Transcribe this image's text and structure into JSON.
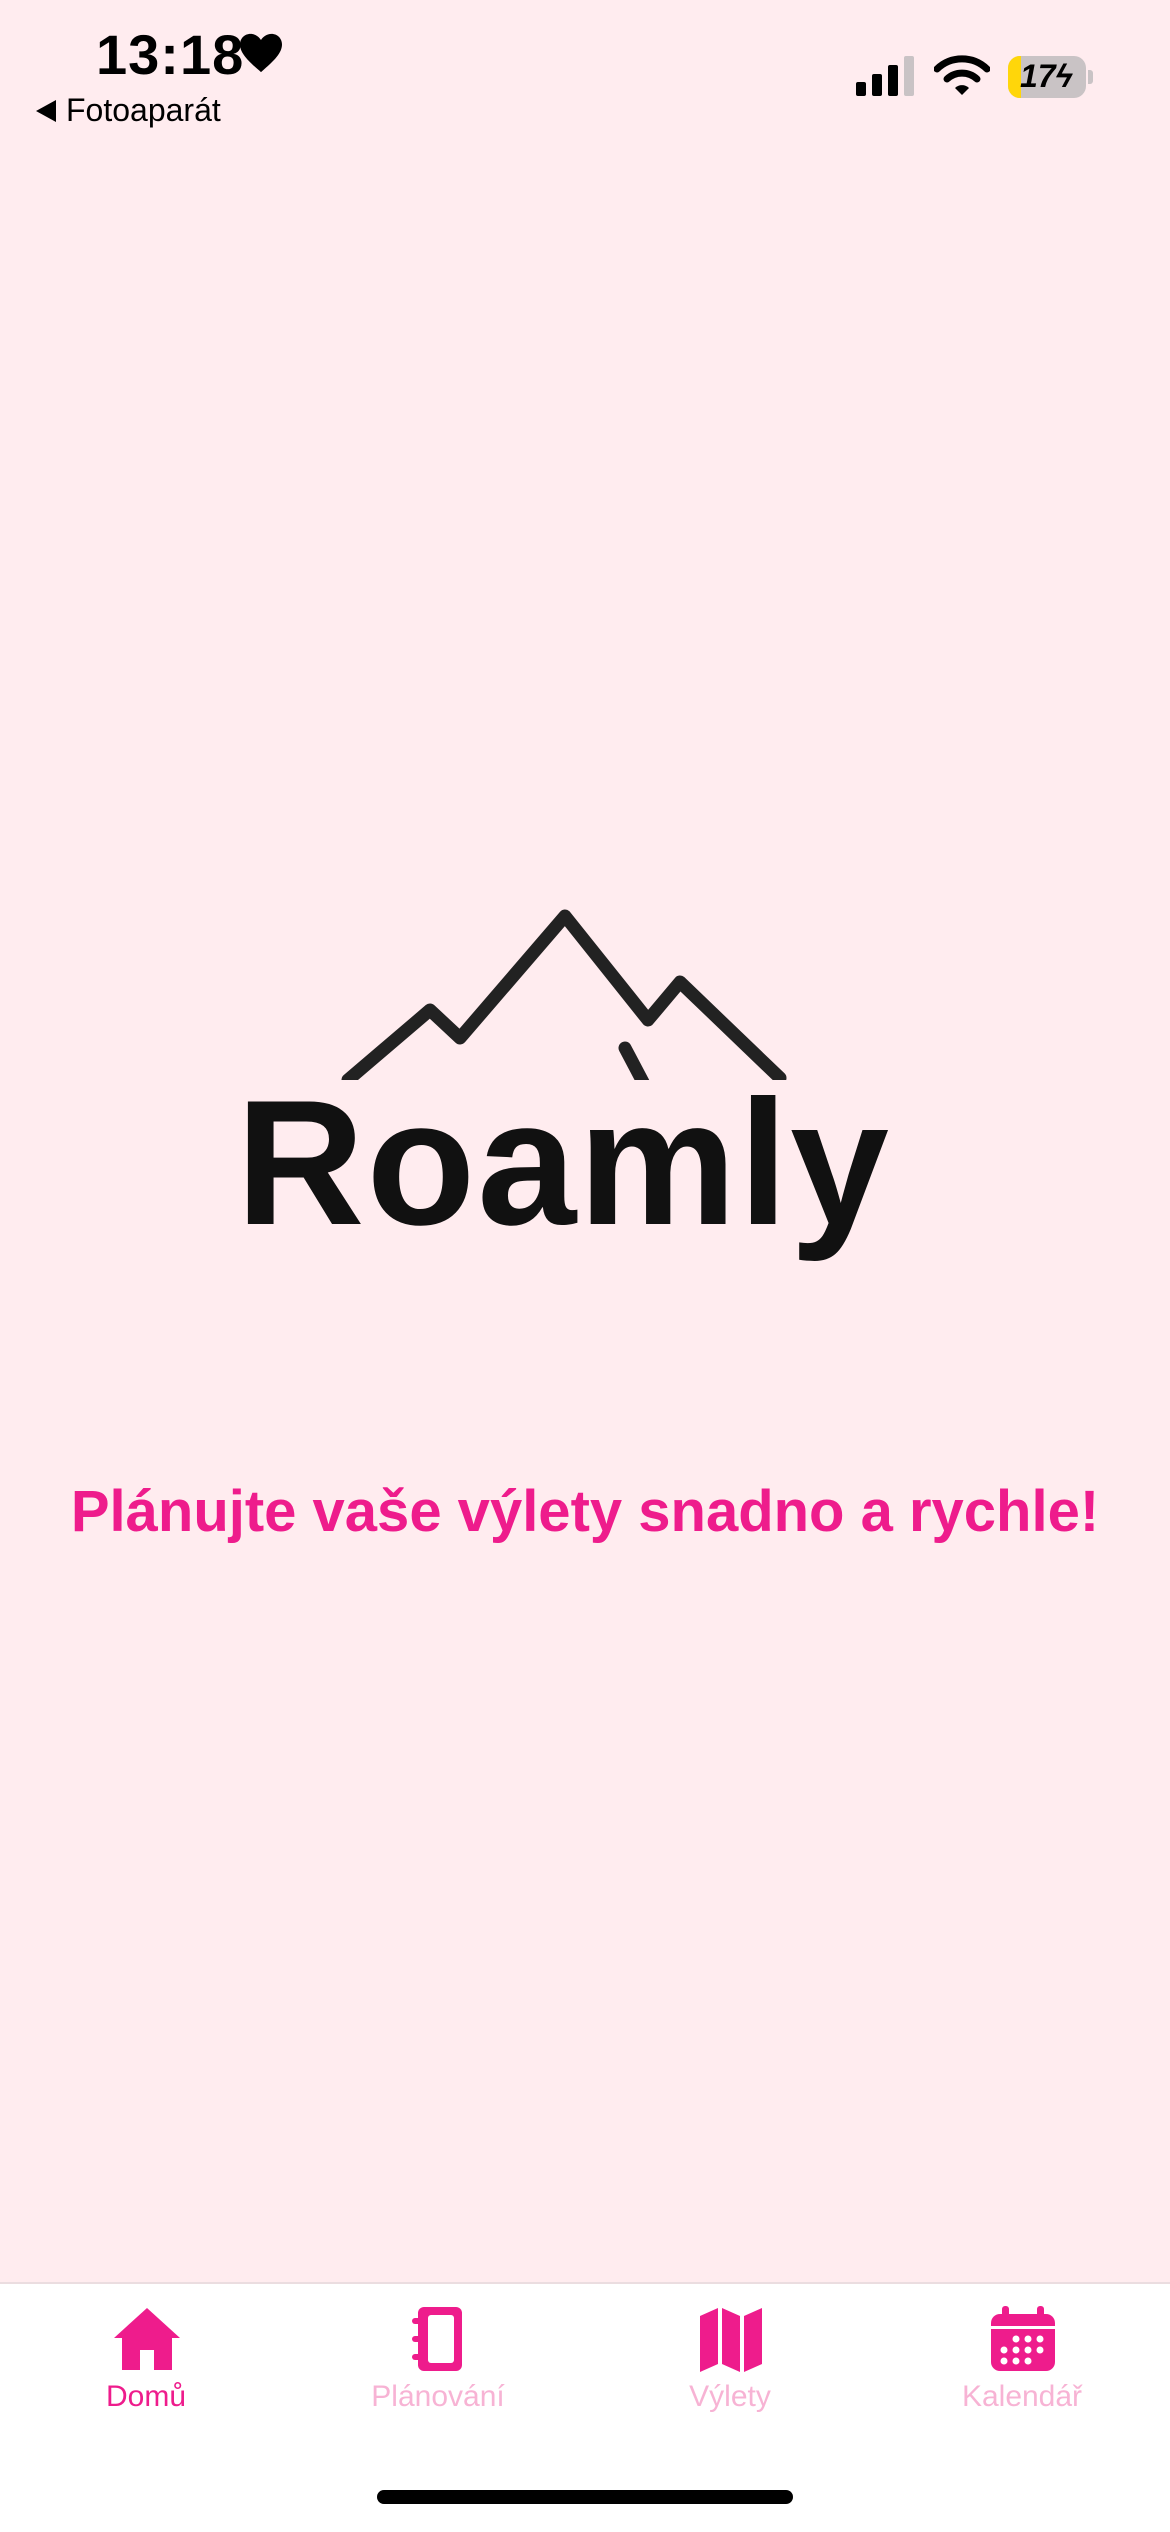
{
  "status_bar": {
    "time": "13:18",
    "back_app": "Fotoaparát",
    "battery_percent": "17",
    "battery_level": 0.17
  },
  "brand": {
    "name": "Roamly",
    "tagline": "Plánujte vaše výlety snadno a rychle!"
  },
  "tabs": [
    {
      "label": "Domů",
      "icon": "home-icon",
      "active": true
    },
    {
      "label": "Plánování",
      "icon": "notebook-icon",
      "active": false
    },
    {
      "label": "Výlety",
      "icon": "map-icon",
      "active": false
    },
    {
      "label": "Kalendář",
      "icon": "calendar-icon",
      "active": false
    }
  ],
  "colors": {
    "background": "#FFECEF",
    "accent": "#EE1C8C",
    "inactive_tab": "#F7B3D4"
  }
}
